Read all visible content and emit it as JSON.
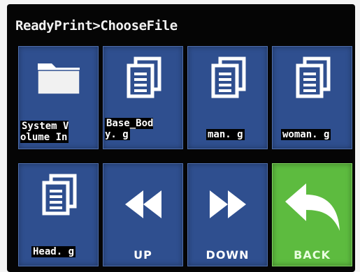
{
  "header": {
    "breadcrumb": "ReadyPrint>ChooseFile"
  },
  "files": [
    {
      "label": "System V\nolume In",
      "icon": "folder-icon"
    },
    {
      "label": "Base_Bod\ny. g",
      "icon": "document-icon"
    },
    {
      "label": "man. g",
      "icon": "document-icon"
    },
    {
      "label": "woman. g",
      "icon": "document-icon"
    },
    {
      "label": "Head. g",
      "icon": "document-icon"
    }
  ],
  "nav": {
    "up": {
      "label": "UP",
      "icon": "double-left-arrow-icon"
    },
    "down": {
      "label": "DOWN",
      "icon": "double-right-arrow-icon"
    },
    "back": {
      "label": "BACK",
      "icon": "back-arrow-icon"
    }
  },
  "colors": {
    "tile": "#2f4f8f",
    "back_tile": "#5dbb3f",
    "screen": "#050505"
  }
}
